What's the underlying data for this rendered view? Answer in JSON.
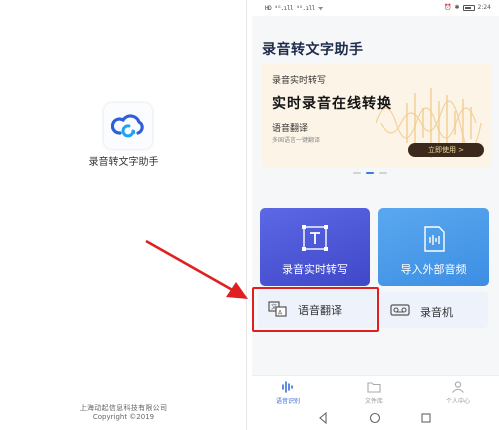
{
  "splash": {
    "app_name": "录音转文字助手",
    "company": "上海动起信息科技有限公司",
    "copyright": "Copyright ©2019"
  },
  "status_bar": {
    "left": "HD ⁴ᴳ.ıll ⁴ᴳ.ıll ᯤ",
    "time": "2:24"
  },
  "app": {
    "title": "录音转文字助手",
    "banner": {
      "subtitle": "录音实时转写",
      "headline": "实时录音在线转换",
      "feature": "语音翻译",
      "description": "多国语言一键翻译",
      "cta": "立即使用 >"
    },
    "tiles": {
      "record": "录音实时转写",
      "import": "导入外部音频"
    },
    "cards": {
      "translate": "语音翻译",
      "recorder": "录音机"
    },
    "nav": [
      {
        "label": "语音识别",
        "icon": "waveform-icon",
        "active": true
      },
      {
        "label": "文件库",
        "icon": "folder-icon",
        "active": false
      },
      {
        "label": "个人中心",
        "icon": "person-icon",
        "active": false
      }
    ]
  },
  "colors": {
    "accent": "#3a6fd8",
    "tile_record": "#4f59d8",
    "tile_import": "#4b9be9",
    "highlight": "#e02020",
    "cta_bg": "#3b2a1c"
  }
}
